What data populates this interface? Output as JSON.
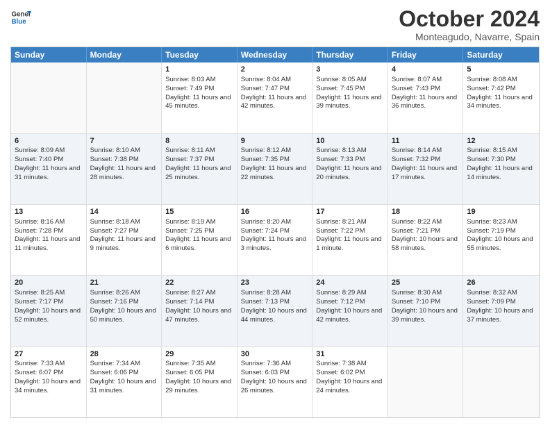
{
  "header": {
    "logo_general": "General",
    "logo_blue": "Blue",
    "month": "October 2024",
    "location": "Monteagudo, Navarre, Spain"
  },
  "days_of_week": [
    "Sunday",
    "Monday",
    "Tuesday",
    "Wednesday",
    "Thursday",
    "Friday",
    "Saturday"
  ],
  "weeks": [
    [
      {
        "day": "",
        "info": ""
      },
      {
        "day": "",
        "info": ""
      },
      {
        "day": "1",
        "info": "Sunrise: 8:03 AM\nSunset: 7:49 PM\nDaylight: 11 hours and 45 minutes."
      },
      {
        "day": "2",
        "info": "Sunrise: 8:04 AM\nSunset: 7:47 PM\nDaylight: 11 hours and 42 minutes."
      },
      {
        "day": "3",
        "info": "Sunrise: 8:05 AM\nSunset: 7:45 PM\nDaylight: 11 hours and 39 minutes."
      },
      {
        "day": "4",
        "info": "Sunrise: 8:07 AM\nSunset: 7:43 PM\nDaylight: 11 hours and 36 minutes."
      },
      {
        "day": "5",
        "info": "Sunrise: 8:08 AM\nSunset: 7:42 PM\nDaylight: 11 hours and 34 minutes."
      }
    ],
    [
      {
        "day": "6",
        "info": "Sunrise: 8:09 AM\nSunset: 7:40 PM\nDaylight: 11 hours and 31 minutes."
      },
      {
        "day": "7",
        "info": "Sunrise: 8:10 AM\nSunset: 7:38 PM\nDaylight: 11 hours and 28 minutes."
      },
      {
        "day": "8",
        "info": "Sunrise: 8:11 AM\nSunset: 7:37 PM\nDaylight: 11 hours and 25 minutes."
      },
      {
        "day": "9",
        "info": "Sunrise: 8:12 AM\nSunset: 7:35 PM\nDaylight: 11 hours and 22 minutes."
      },
      {
        "day": "10",
        "info": "Sunrise: 8:13 AM\nSunset: 7:33 PM\nDaylight: 11 hours and 20 minutes."
      },
      {
        "day": "11",
        "info": "Sunrise: 8:14 AM\nSunset: 7:32 PM\nDaylight: 11 hours and 17 minutes."
      },
      {
        "day": "12",
        "info": "Sunrise: 8:15 AM\nSunset: 7:30 PM\nDaylight: 11 hours and 14 minutes."
      }
    ],
    [
      {
        "day": "13",
        "info": "Sunrise: 8:16 AM\nSunset: 7:28 PM\nDaylight: 11 hours and 11 minutes."
      },
      {
        "day": "14",
        "info": "Sunrise: 8:18 AM\nSunset: 7:27 PM\nDaylight: 11 hours and 9 minutes."
      },
      {
        "day": "15",
        "info": "Sunrise: 8:19 AM\nSunset: 7:25 PM\nDaylight: 11 hours and 6 minutes."
      },
      {
        "day": "16",
        "info": "Sunrise: 8:20 AM\nSunset: 7:24 PM\nDaylight: 11 hours and 3 minutes."
      },
      {
        "day": "17",
        "info": "Sunrise: 8:21 AM\nSunset: 7:22 PM\nDaylight: 11 hours and 1 minute."
      },
      {
        "day": "18",
        "info": "Sunrise: 8:22 AM\nSunset: 7:21 PM\nDaylight: 10 hours and 58 minutes."
      },
      {
        "day": "19",
        "info": "Sunrise: 8:23 AM\nSunset: 7:19 PM\nDaylight: 10 hours and 55 minutes."
      }
    ],
    [
      {
        "day": "20",
        "info": "Sunrise: 8:25 AM\nSunset: 7:17 PM\nDaylight: 10 hours and 52 minutes."
      },
      {
        "day": "21",
        "info": "Sunrise: 8:26 AM\nSunset: 7:16 PM\nDaylight: 10 hours and 50 minutes."
      },
      {
        "day": "22",
        "info": "Sunrise: 8:27 AM\nSunset: 7:14 PM\nDaylight: 10 hours and 47 minutes."
      },
      {
        "day": "23",
        "info": "Sunrise: 8:28 AM\nSunset: 7:13 PM\nDaylight: 10 hours and 44 minutes."
      },
      {
        "day": "24",
        "info": "Sunrise: 8:29 AM\nSunset: 7:12 PM\nDaylight: 10 hours and 42 minutes."
      },
      {
        "day": "25",
        "info": "Sunrise: 8:30 AM\nSunset: 7:10 PM\nDaylight: 10 hours and 39 minutes."
      },
      {
        "day": "26",
        "info": "Sunrise: 8:32 AM\nSunset: 7:09 PM\nDaylight: 10 hours and 37 minutes."
      }
    ],
    [
      {
        "day": "27",
        "info": "Sunrise: 7:33 AM\nSunset: 6:07 PM\nDaylight: 10 hours and 34 minutes."
      },
      {
        "day": "28",
        "info": "Sunrise: 7:34 AM\nSunset: 6:06 PM\nDaylight: 10 hours and 31 minutes."
      },
      {
        "day": "29",
        "info": "Sunrise: 7:35 AM\nSunset: 6:05 PM\nDaylight: 10 hours and 29 minutes."
      },
      {
        "day": "30",
        "info": "Sunrise: 7:36 AM\nSunset: 6:03 PM\nDaylight: 10 hours and 26 minutes."
      },
      {
        "day": "31",
        "info": "Sunrise: 7:38 AM\nSunset: 6:02 PM\nDaylight: 10 hours and 24 minutes."
      },
      {
        "day": "",
        "info": ""
      },
      {
        "day": "",
        "info": ""
      }
    ]
  ]
}
